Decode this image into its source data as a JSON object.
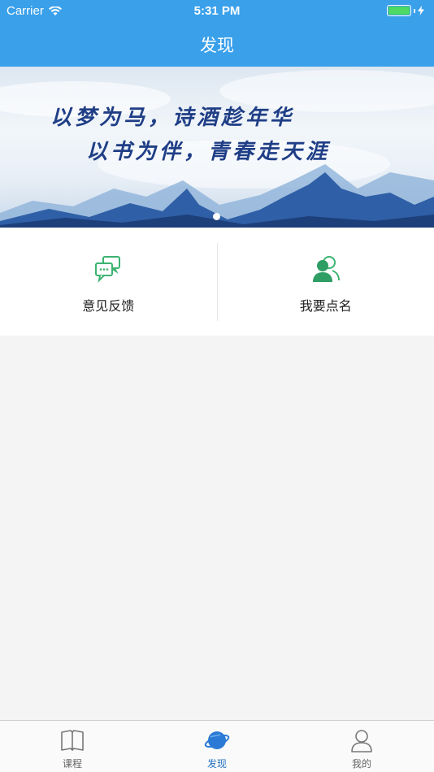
{
  "status_bar": {
    "carrier": "Carrier",
    "time": "5:31 PM"
  },
  "nav": {
    "title": "发现"
  },
  "banner": {
    "line1": "以梦为马，诗酒趁年华",
    "line2": "以书为伴，青春走天涯"
  },
  "features": [
    {
      "label": "意见反馈",
      "icon": "chat-bubbles-icon"
    },
    {
      "label": "我要点名",
      "icon": "users-icon"
    }
  ],
  "tabs": [
    {
      "label": "课程",
      "icon": "book-icon",
      "active": false
    },
    {
      "label": "发现",
      "icon": "planet-icon",
      "active": true
    },
    {
      "label": "我的",
      "icon": "person-icon",
      "active": false
    }
  ],
  "colors": {
    "nav_blue": "#3aa0ea",
    "accent_green": "#3cb371",
    "active_tab": "#1f6fbf",
    "background": "#f4f4f4"
  }
}
